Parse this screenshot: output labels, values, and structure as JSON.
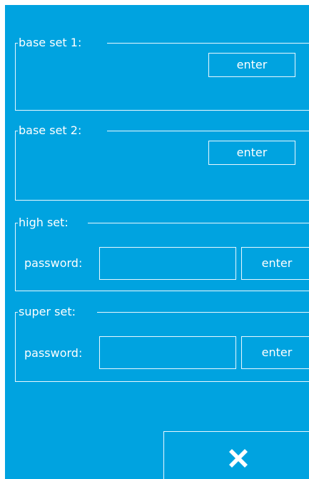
{
  "groups": {
    "base_set_1": {
      "title": "base set 1:",
      "enter_label": "enter"
    },
    "base_set_2": {
      "title": "base set 2:",
      "enter_label": "enter"
    },
    "high_set": {
      "title": "high set:",
      "password_label": "password:",
      "password_value": "",
      "enter_label": "enter"
    },
    "super_set": {
      "title": "super set:",
      "password_label": "password:",
      "password_value": "",
      "enter_label": "enter"
    }
  },
  "close_button": {
    "icon": "close-icon"
  },
  "colors": {
    "background": "#00a3e0",
    "border": "#e8f8ff",
    "text": "#ffffff"
  }
}
